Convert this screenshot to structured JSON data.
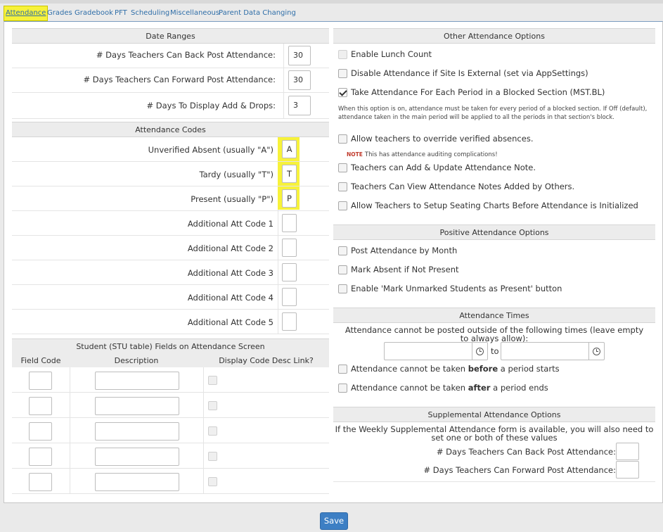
{
  "tabs": [
    {
      "label": "Attendance",
      "active": true
    },
    {
      "label": "Grades"
    },
    {
      "label": "Gradebook"
    },
    {
      "label": "PFT"
    },
    {
      "label": "Scheduling"
    },
    {
      "label": "Miscellaneous"
    },
    {
      "label": "Parent Data Changing"
    }
  ],
  "date_ranges": {
    "header": "Date Ranges",
    "rows": [
      {
        "label": "# Days Teachers Can Back Post Attendance:",
        "value": "30"
      },
      {
        "label": "# Days Teachers Can Forward Post Attendance:",
        "value": "30"
      },
      {
        "label": "# Days To Display Add & Drops:",
        "value": "3"
      }
    ]
  },
  "attendance_codes": {
    "header": "Attendance Codes",
    "rows": [
      {
        "label": "Unverified Absent (usually \"A\")",
        "value": "A"
      },
      {
        "label": "Tardy (usually \"T\")",
        "value": "T"
      },
      {
        "label": "Present (usually \"P\")",
        "value": "P"
      },
      {
        "label": "Additional Att Code 1",
        "value": ""
      },
      {
        "label": "Additional Att Code 2",
        "value": ""
      },
      {
        "label": "Additional Att Code 3",
        "value": ""
      },
      {
        "label": "Additional Att Code 4",
        "value": ""
      },
      {
        "label": "Additional Att Code 5",
        "value": ""
      }
    ]
  },
  "student_fields": {
    "header": "Student (STU table) Fields on Attendance Screen",
    "columns": [
      "Field Code",
      "Description",
      "Display Code Desc Link?"
    ]
  },
  "other_options": {
    "header": "Other Attendance Options",
    "lunch_count": "Enable Lunch Count",
    "disable_external": "Disable Attendance if Site Is External (set via AppSettings)",
    "blocked_section": "Take Attendance For Each Period in a Blocked Section (MST.BL)",
    "blocked_note": "When this option is on, attendance must be taken for every period of a blocked section. If Off (default), attendance taken in the main period will be applied to all the periods in that section's block.",
    "override_verified": "Allow teachers to override verified absences.",
    "note_tag": "NOTE",
    "note_text": "This has attendance auditing complications!",
    "add_update_note": "Teachers can Add & Update Attendance Note.",
    "view_notes": "Teachers Can View Attendance Notes Added by Others.",
    "seating_charts": "Allow Teachers to Setup Seating Charts Before Attendance is Initialized"
  },
  "positive_options": {
    "header": "Positive Attendance Options",
    "post_by_month": "Post Attendance by Month",
    "mark_absent": "Mark Absent if Not Present",
    "enable_unmarked": "Enable 'Mark Unmarked Students as Present' button"
  },
  "attendance_times": {
    "header": "Attendance Times",
    "description": "Attendance cannot be posted outside of the following times (leave empty to always allow):",
    "to_label": "to",
    "before_prefix": "Attendance cannot be taken ",
    "before_bold": "before",
    "before_suffix": " a period starts",
    "after_prefix": "Attendance cannot be taken ",
    "after_bold": "after",
    "after_suffix": " a period ends"
  },
  "supplemental": {
    "header": "Supplemental Attendance Options",
    "description": "If the Weekly Supplemental Attendance form is available, you will also need to set one or both of these values",
    "back_post": "# Days Teachers Can Back Post Attendance:",
    "forward_post": "# Days Teachers Can Forward Post Attendance:"
  },
  "save_label": "Save",
  "colors": {
    "accent": "#3d7fc4",
    "highlight": "#f7f23a",
    "link": "#2f6ea8"
  }
}
